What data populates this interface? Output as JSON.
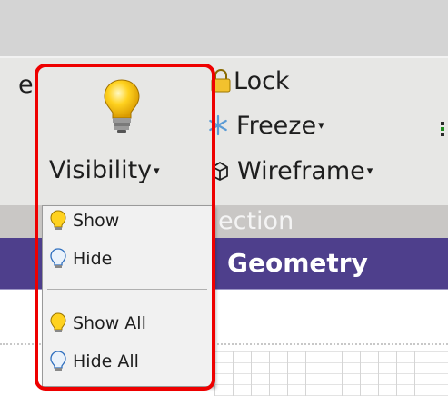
{
  "ribbon": {
    "left_clipped_text": "e",
    "visibility_label": "Visibility",
    "lock_label": "Lock",
    "freeze_label": "Freeze",
    "wireframe_label": "Wireframe",
    "group_label": "ection"
  },
  "title_bar": {
    "text": "Geometry"
  },
  "visibility_menu": {
    "items": [
      {
        "label": "Show",
        "icon": "bulb-on-icon"
      },
      {
        "label": "Hide",
        "icon": "bulb-off-icon"
      },
      {
        "label": "Show All",
        "icon": "bulb-on-icon"
      },
      {
        "label": "Hide All",
        "icon": "bulb-off-icon"
      }
    ]
  },
  "colors": {
    "highlight": "#ee0000",
    "title_bar": "#4e3f8c",
    "ribbon": "#e7e7e5",
    "menu_bg": "#f1f1f1"
  }
}
